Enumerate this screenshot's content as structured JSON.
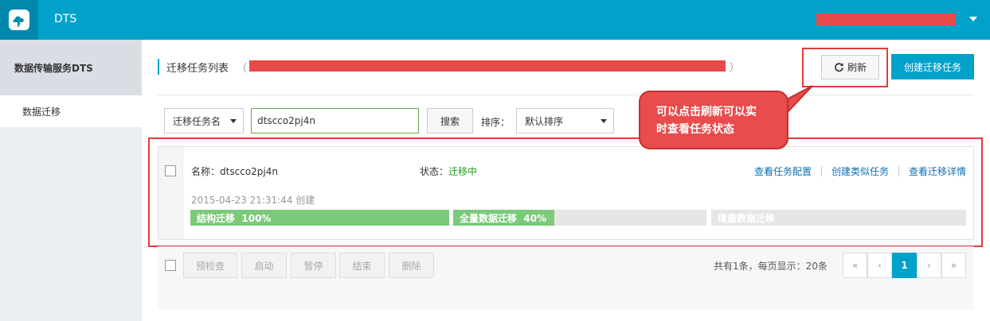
{
  "header": {
    "app_title": "DTS",
    "logo_icon": "cloud-logo-icon",
    "user_menu_icon": "caret-down-icon"
  },
  "sidebar": {
    "section_title": "数据传输服务DTS",
    "items": [
      {
        "label": "数据迁移"
      }
    ]
  },
  "page": {
    "title": "迁移任务列表",
    "paren_open": "（",
    "paren_close": "）",
    "refresh_label": "刷新",
    "refresh_icon": "refresh-icon",
    "create_label": "创建迁移任务"
  },
  "filter": {
    "field_select": "迁移任务名",
    "search_value": "dtscco2pj4n",
    "search_button": "搜索",
    "sort_label": "排序：",
    "sort_select": "默认排序"
  },
  "callout": {
    "line1": "可以点击刷新可以实",
    "line2": "时查看任务状态"
  },
  "task": {
    "name_label": "名称：",
    "name": "dtscco2pj4n",
    "status_label": "状态：",
    "status_value": "迁移中",
    "links": [
      "查看任务配置",
      "创建类似任务",
      "查看迁移详情"
    ],
    "created": "2015-04-23 21:31:44 创建",
    "progress": [
      {
        "label": "结构迁移",
        "percent_text": "100%",
        "fill": 1.0
      },
      {
        "label": "全量数据迁移",
        "percent_text": "40%",
        "fill": 0.4
      },
      {
        "label": "增量数据迁移",
        "percent_text": "",
        "fill": 0.0
      }
    ]
  },
  "footer": {
    "buttons": [
      "预检查",
      "启动",
      "暂停",
      "结束",
      "删除"
    ],
    "summary": "共有1条，每页显示：20条",
    "pager": [
      "«",
      "‹",
      "1",
      "›",
      "»"
    ],
    "current_page": "1"
  },
  "colors": {
    "brand": "#00a2ca",
    "highlight": "#e03b3b",
    "progress_done": "#7cc97c",
    "status_green": "#1ea11e",
    "link_blue": "#0a6fb3"
  }
}
